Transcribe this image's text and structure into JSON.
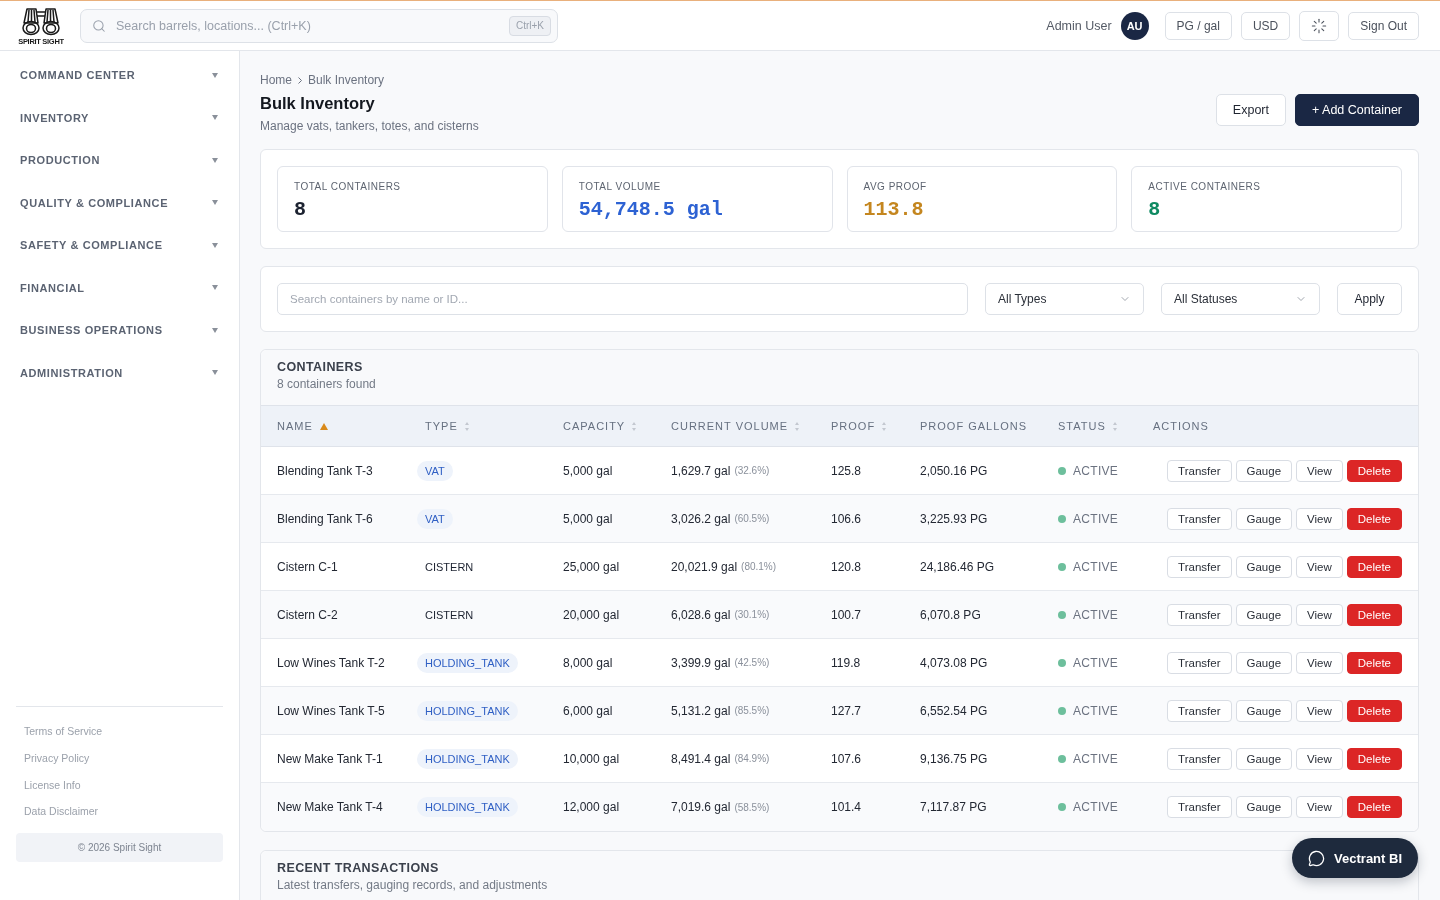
{
  "top_bar": {
    "logo_text": "SPIRIT SIGHT",
    "search": {
      "placeholder": "Search barrels, locations... (Ctrl+K)",
      "shortcut": "Ctrl+K"
    },
    "user_name": "Admin User",
    "avatar_initials": "AU",
    "buttons": [
      {
        "kind": "text",
        "label": "PG / gal"
      },
      {
        "kind": "text",
        "label": "USD"
      },
      {
        "kind": "icon"
      },
      {
        "kind": "text",
        "label": "Sign Out"
      }
    ]
  },
  "sidebar": {
    "items": [
      "COMMAND CENTER",
      "INVENTORY",
      "PRODUCTION",
      "QUALITY & COMPLIANCE",
      "SAFETY & COMPLIANCE",
      "FINANCIAL",
      "BUSINESS OPERATIONS",
      "ADMINISTRATION"
    ],
    "footer_links": [
      "Terms of Service",
      "Privacy Policy",
      "License Info",
      "Data Disclaimer"
    ],
    "copyright": "© 2026 Spirit Sight"
  },
  "page": {
    "breadcrumb": [
      "Home",
      "Bulk Inventory"
    ],
    "title": "Bulk Inventory",
    "subtitle": "Manage vats, tankers, totes, and cisterns",
    "actions": [
      {
        "kind": "secondary",
        "label": "Export"
      },
      {
        "kind": "primary",
        "label": "+ Add Container"
      }
    ]
  },
  "stats": [
    {
      "label": "TOTAL CONTAINERS",
      "value": "8",
      "color": "#1c2230"
    },
    {
      "label": "TOTAL VOLUME",
      "value": "54,748.5 gal",
      "color": "#2d62d3"
    },
    {
      "label": "AVG PROOF",
      "value": "113.8",
      "color": "#c4861f"
    },
    {
      "label": "ACTIVE CONTAINERS",
      "value": "8",
      "color": "#0f8a62"
    }
  ],
  "filters": {
    "search": {
      "placeholder": "Search containers by name or ID..."
    },
    "selects": [
      {
        "value": "All Types"
      },
      {
        "value": "All Statuses"
      }
    ],
    "apply_label": "Apply"
  },
  "containers": {
    "title": "CONTAINERS",
    "count_text": "8 containers found",
    "columns": [
      {
        "label": "NAME",
        "sortable": true,
        "sorted": true
      },
      {
        "label": "TYPE",
        "sortable": true,
        "sorted": false
      },
      {
        "label": "CAPACITY",
        "sortable": true,
        "sorted": false
      },
      {
        "label": "CURRENT VOLUME",
        "sortable": true,
        "sorted": false
      },
      {
        "label": "PROOF",
        "sortable": true,
        "sorted": false
      },
      {
        "label": "PROOF GALLONS",
        "sortable": false,
        "sorted": false
      },
      {
        "label": "STATUS",
        "sortable": true,
        "sorted": false
      },
      {
        "label": "ACTIONS",
        "sortable": false,
        "sorted": false
      }
    ],
    "rows": [
      {
        "name": "Blending Tank T-3",
        "type": {
          "label": "VAT",
          "tinted": true
        },
        "capacity": "5,000 gal",
        "volume": "1,629.7 gal",
        "volume_percent": "(32.6%)",
        "proof": "125.8",
        "proof_gallons": "2,050.16 PG",
        "status": "ACTIVE",
        "actions": [
          {
            "kind": "default",
            "label": "Transfer"
          },
          {
            "kind": "default",
            "label": "Gauge"
          },
          {
            "kind": "default",
            "label": "View"
          },
          {
            "kind": "danger",
            "label": "Delete"
          }
        ]
      },
      {
        "name": "Blending Tank T-6",
        "type": {
          "label": "VAT",
          "tinted": true
        },
        "capacity": "5,000 gal",
        "volume": "3,026.2 gal",
        "volume_percent": "(60.5%)",
        "proof": "106.6",
        "proof_gallons": "3,225.93 PG",
        "status": "ACTIVE",
        "actions": [
          {
            "kind": "default",
            "label": "Transfer"
          },
          {
            "kind": "default",
            "label": "Gauge"
          },
          {
            "kind": "default",
            "label": "View"
          },
          {
            "kind": "danger",
            "label": "Delete"
          }
        ]
      },
      {
        "name": "Cistern C-1",
        "type": {
          "label": "CISTERN",
          "tinted": false
        },
        "capacity": "25,000 gal",
        "volume": "20,021.9 gal",
        "volume_percent": "(80.1%)",
        "proof": "120.8",
        "proof_gallons": "24,186.46 PG",
        "status": "ACTIVE",
        "actions": [
          {
            "kind": "default",
            "label": "Transfer"
          },
          {
            "kind": "default",
            "label": "Gauge"
          },
          {
            "kind": "default",
            "label": "View"
          },
          {
            "kind": "danger",
            "label": "Delete"
          }
        ]
      },
      {
        "name": "Cistern C-2",
        "type": {
          "label": "CISTERN",
          "tinted": false
        },
        "capacity": "20,000 gal",
        "volume": "6,028.6 gal",
        "volume_percent": "(30.1%)",
        "proof": "100.7",
        "proof_gallons": "6,070.8 PG",
        "status": "ACTIVE",
        "actions": [
          {
            "kind": "default",
            "label": "Transfer"
          },
          {
            "kind": "default",
            "label": "Gauge"
          },
          {
            "kind": "default",
            "label": "View"
          },
          {
            "kind": "danger",
            "label": "Delete"
          }
        ]
      },
      {
        "name": "Low Wines Tank T-2",
        "type": {
          "label": "HOLDING_TANK",
          "tinted": true
        },
        "capacity": "8,000 gal",
        "volume": "3,399.9 gal",
        "volume_percent": "(42.5%)",
        "proof": "119.8",
        "proof_gallons": "4,073.08 PG",
        "status": "ACTIVE",
        "actions": [
          {
            "kind": "default",
            "label": "Transfer"
          },
          {
            "kind": "default",
            "label": "Gauge"
          },
          {
            "kind": "default",
            "label": "View"
          },
          {
            "kind": "danger",
            "label": "Delete"
          }
        ]
      },
      {
        "name": "Low Wines Tank T-5",
        "type": {
          "label": "HOLDING_TANK",
          "tinted": true
        },
        "capacity": "6,000 gal",
        "volume": "5,131.2 gal",
        "volume_percent": "(85.5%)",
        "proof": "127.7",
        "proof_gallons": "6,552.54 PG",
        "status": "ACTIVE",
        "actions": [
          {
            "kind": "default",
            "label": "Transfer"
          },
          {
            "kind": "default",
            "label": "Gauge"
          },
          {
            "kind": "default",
            "label": "View"
          },
          {
            "kind": "danger",
            "label": "Delete"
          }
        ]
      },
      {
        "name": "New Make Tank T-1",
        "type": {
          "label": "HOLDING_TANK",
          "tinted": true
        },
        "capacity": "10,000 gal",
        "volume": "8,491.4 gal",
        "volume_percent": "(84.9%)",
        "proof": "107.6",
        "proof_gallons": "9,136.75 PG",
        "status": "ACTIVE",
        "actions": [
          {
            "kind": "default",
            "label": "Transfer"
          },
          {
            "kind": "default",
            "label": "Gauge"
          },
          {
            "kind": "default",
            "label": "View"
          },
          {
            "kind": "danger",
            "label": "Delete"
          }
        ]
      },
      {
        "name": "New Make Tank T-4",
        "type": {
          "label": "HOLDING_TANK",
          "tinted": true
        },
        "capacity": "12,000 gal",
        "volume": "7,019.6 gal",
        "volume_percent": "(58.5%)",
        "proof": "101.4",
        "proof_gallons": "7,117.87 PG",
        "status": "ACTIVE",
        "actions": [
          {
            "kind": "default",
            "label": "Transfer"
          },
          {
            "kind": "default",
            "label": "Gauge"
          },
          {
            "kind": "default",
            "label": "View"
          },
          {
            "kind": "danger",
            "label": "Delete"
          }
        ]
      }
    ]
  },
  "recent_transactions": {
    "title": "RECENT TRANSACTIONS",
    "subtitle": "Latest transfers, gauging records, and adjustments"
  },
  "chat_button": {
    "label": "Vectrant BI"
  }
}
